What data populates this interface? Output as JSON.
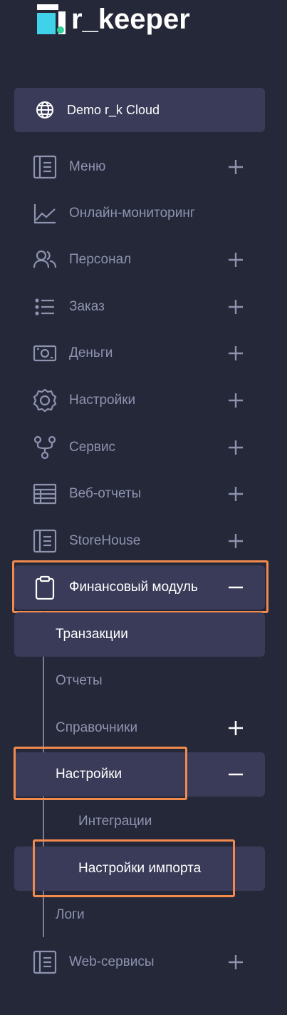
{
  "brand": {
    "logo_text": "r_keeper"
  },
  "workspace": {
    "label": "Demo r_k Cloud"
  },
  "nav": {
    "menu": "Меню",
    "monitoring": "Онлайн-мониторинг",
    "personnel": "Персонал",
    "order": "Заказ",
    "money": "Деньги",
    "settings": "Настройки",
    "service": "Сервис",
    "webreports": "Веб-отчеты",
    "storehouse": "StoreHouse",
    "finance": "Финансовый модуль",
    "finance_children": {
      "transactions": "Транзакции",
      "reports": "Отчеты",
      "references": "Справочники",
      "settings": "Настройки",
      "settings_children": {
        "integrations": "Интеграции",
        "import_settings": "Настройки импорта"
      },
      "logs": "Логи"
    },
    "webservices": "Web-сервисы"
  },
  "colors": {
    "background": "#252838",
    "active_item": "#3a3b58",
    "muted_text": "#8e93b0",
    "highlight": "#f28a4e"
  }
}
